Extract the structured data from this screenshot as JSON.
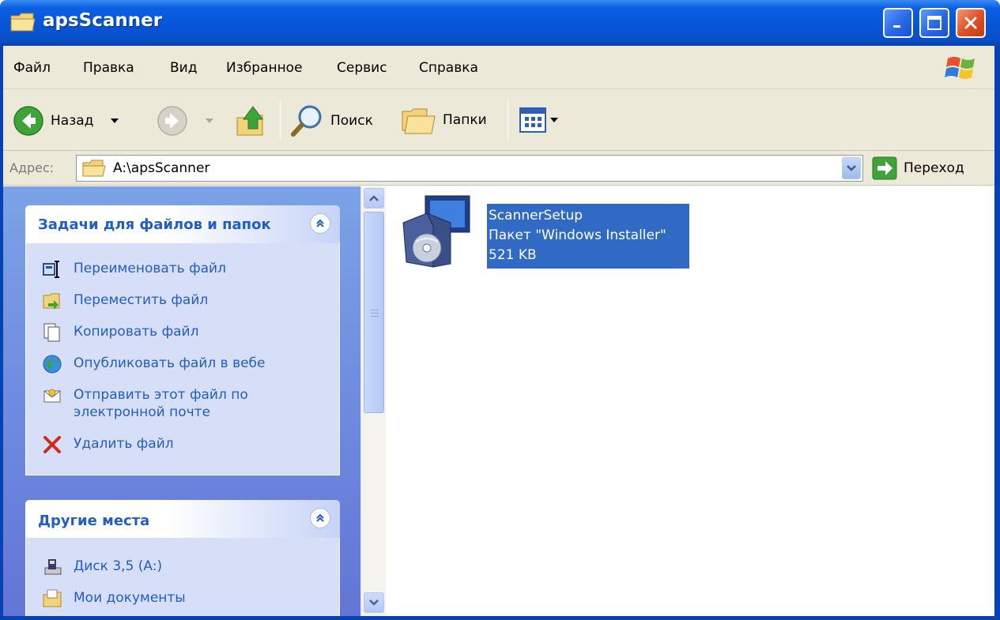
{
  "window": {
    "title": "apsScanner",
    "title_icon": "folder-icon",
    "buttons": [
      "minimize",
      "maximize",
      "close"
    ]
  },
  "menu": [
    "Файл",
    "Правка",
    "Вид",
    "Избранное",
    "Сервис",
    "Справка"
  ],
  "toolbar": {
    "back_label": "Назад",
    "search_label": "Поиск",
    "folders_label": "Папки"
  },
  "address": {
    "label": "Адрес:",
    "value": "A:\\apsScanner",
    "go_label": "Переход"
  },
  "tasks_panel": {
    "title": "Задачи для файлов и папок",
    "items": [
      {
        "label": "Переименовать файл",
        "icon": "rename-icon"
      },
      {
        "label": "Переместить файл",
        "icon": "move-icon"
      },
      {
        "label": "Копировать файл",
        "icon": "copy-icon"
      },
      {
        "label": "Опубликовать файл в вебе",
        "icon": "globe-icon"
      },
      {
        "label": "Отправить этот файл по электронной почте",
        "icon": "mail-icon"
      },
      {
        "label": "Удалить файл",
        "icon": "delete-icon"
      }
    ]
  },
  "places_panel": {
    "title": "Другие места",
    "items": [
      {
        "label": "Диск 3,5 (A:)",
        "icon": "floppy-drive-icon"
      },
      {
        "label": "Мои документы",
        "icon": "my-documents-icon"
      }
    ]
  },
  "files": [
    {
      "name": "ScannerSetup",
      "type": "Пакет \"Windows Installer\"",
      "size": "521 KB",
      "selected": true
    }
  ],
  "colors": {
    "titlebar": "#0654d6",
    "taskpane": "#6f8fe0",
    "link": "#215dc6",
    "selection": "#316ac5"
  }
}
